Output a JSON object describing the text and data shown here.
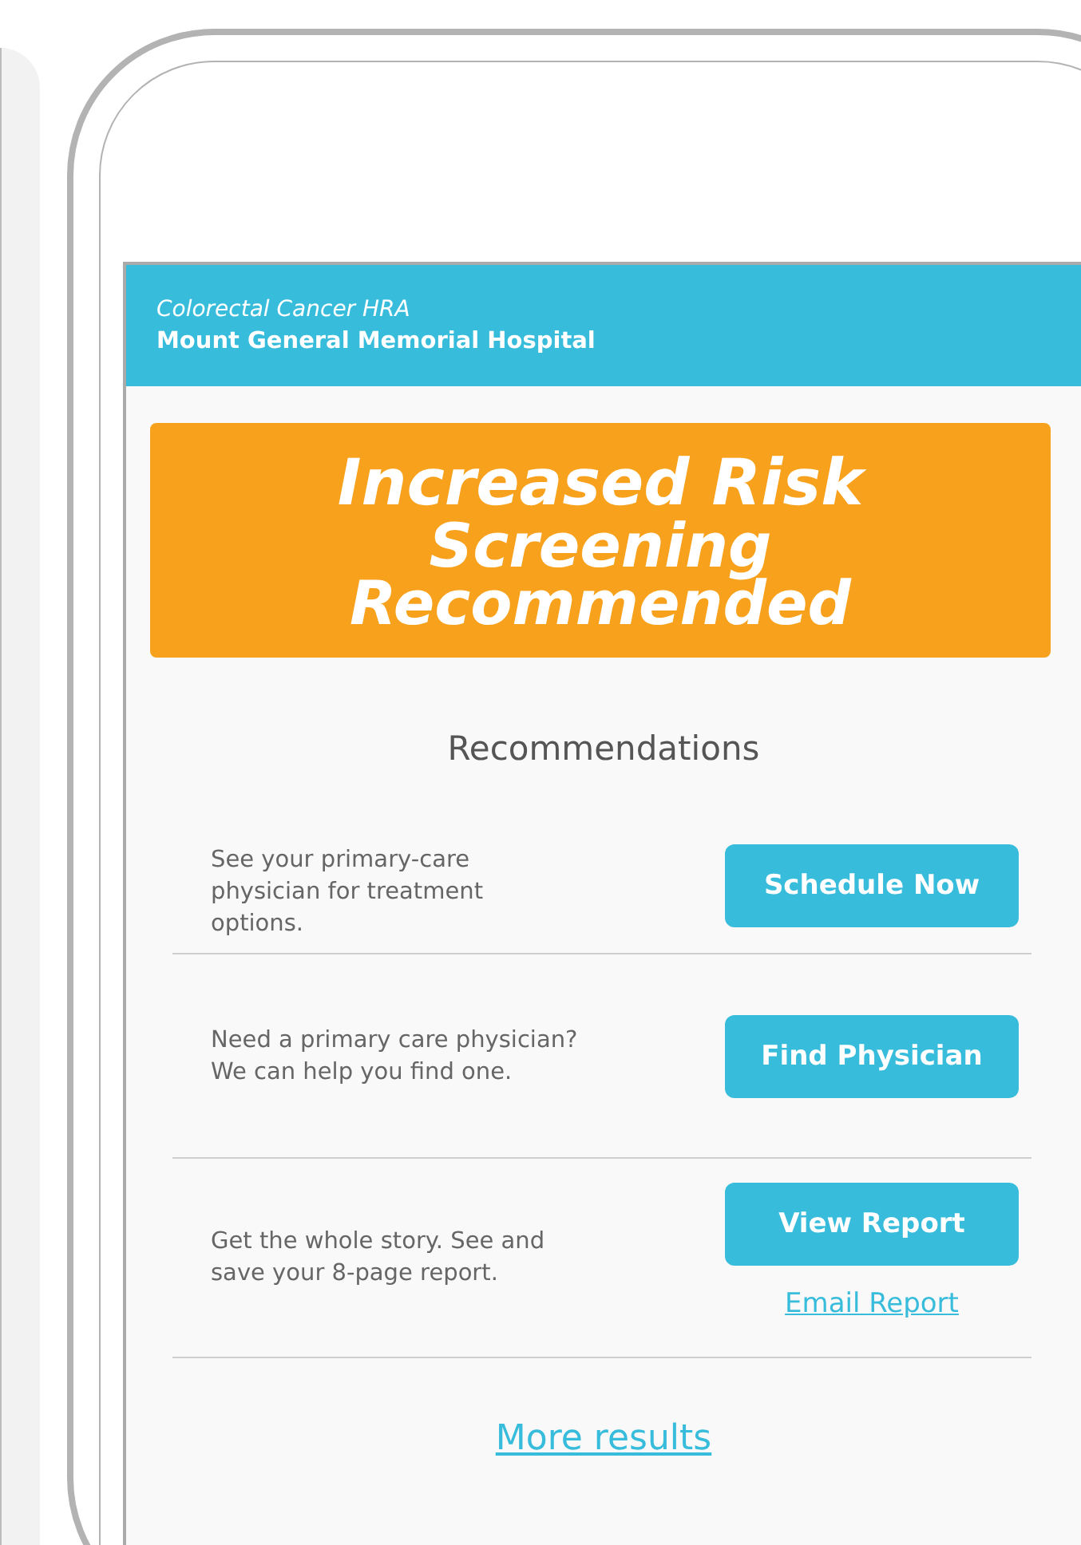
{
  "header": {
    "subtitle": "Colorectal Cancer HRA",
    "title": "Mount General Memorial Hospital"
  },
  "banner": {
    "title": "Increased Risk",
    "subtitle": "Screening\nRecommended"
  },
  "section_title": "Recommendations",
  "recommendations": [
    {
      "text": "See your primary-care\nphysician for treatment\noptions.",
      "button": "Schedule Now"
    },
    {
      "text": "Need a primary care physician?\nWe can help you find one.",
      "button": "Find Physician"
    },
    {
      "text": "Get the whole story. See and\nsave your 8-page report.",
      "button": "View Report",
      "link": "Email Report"
    }
  ],
  "more_link": "More results"
}
